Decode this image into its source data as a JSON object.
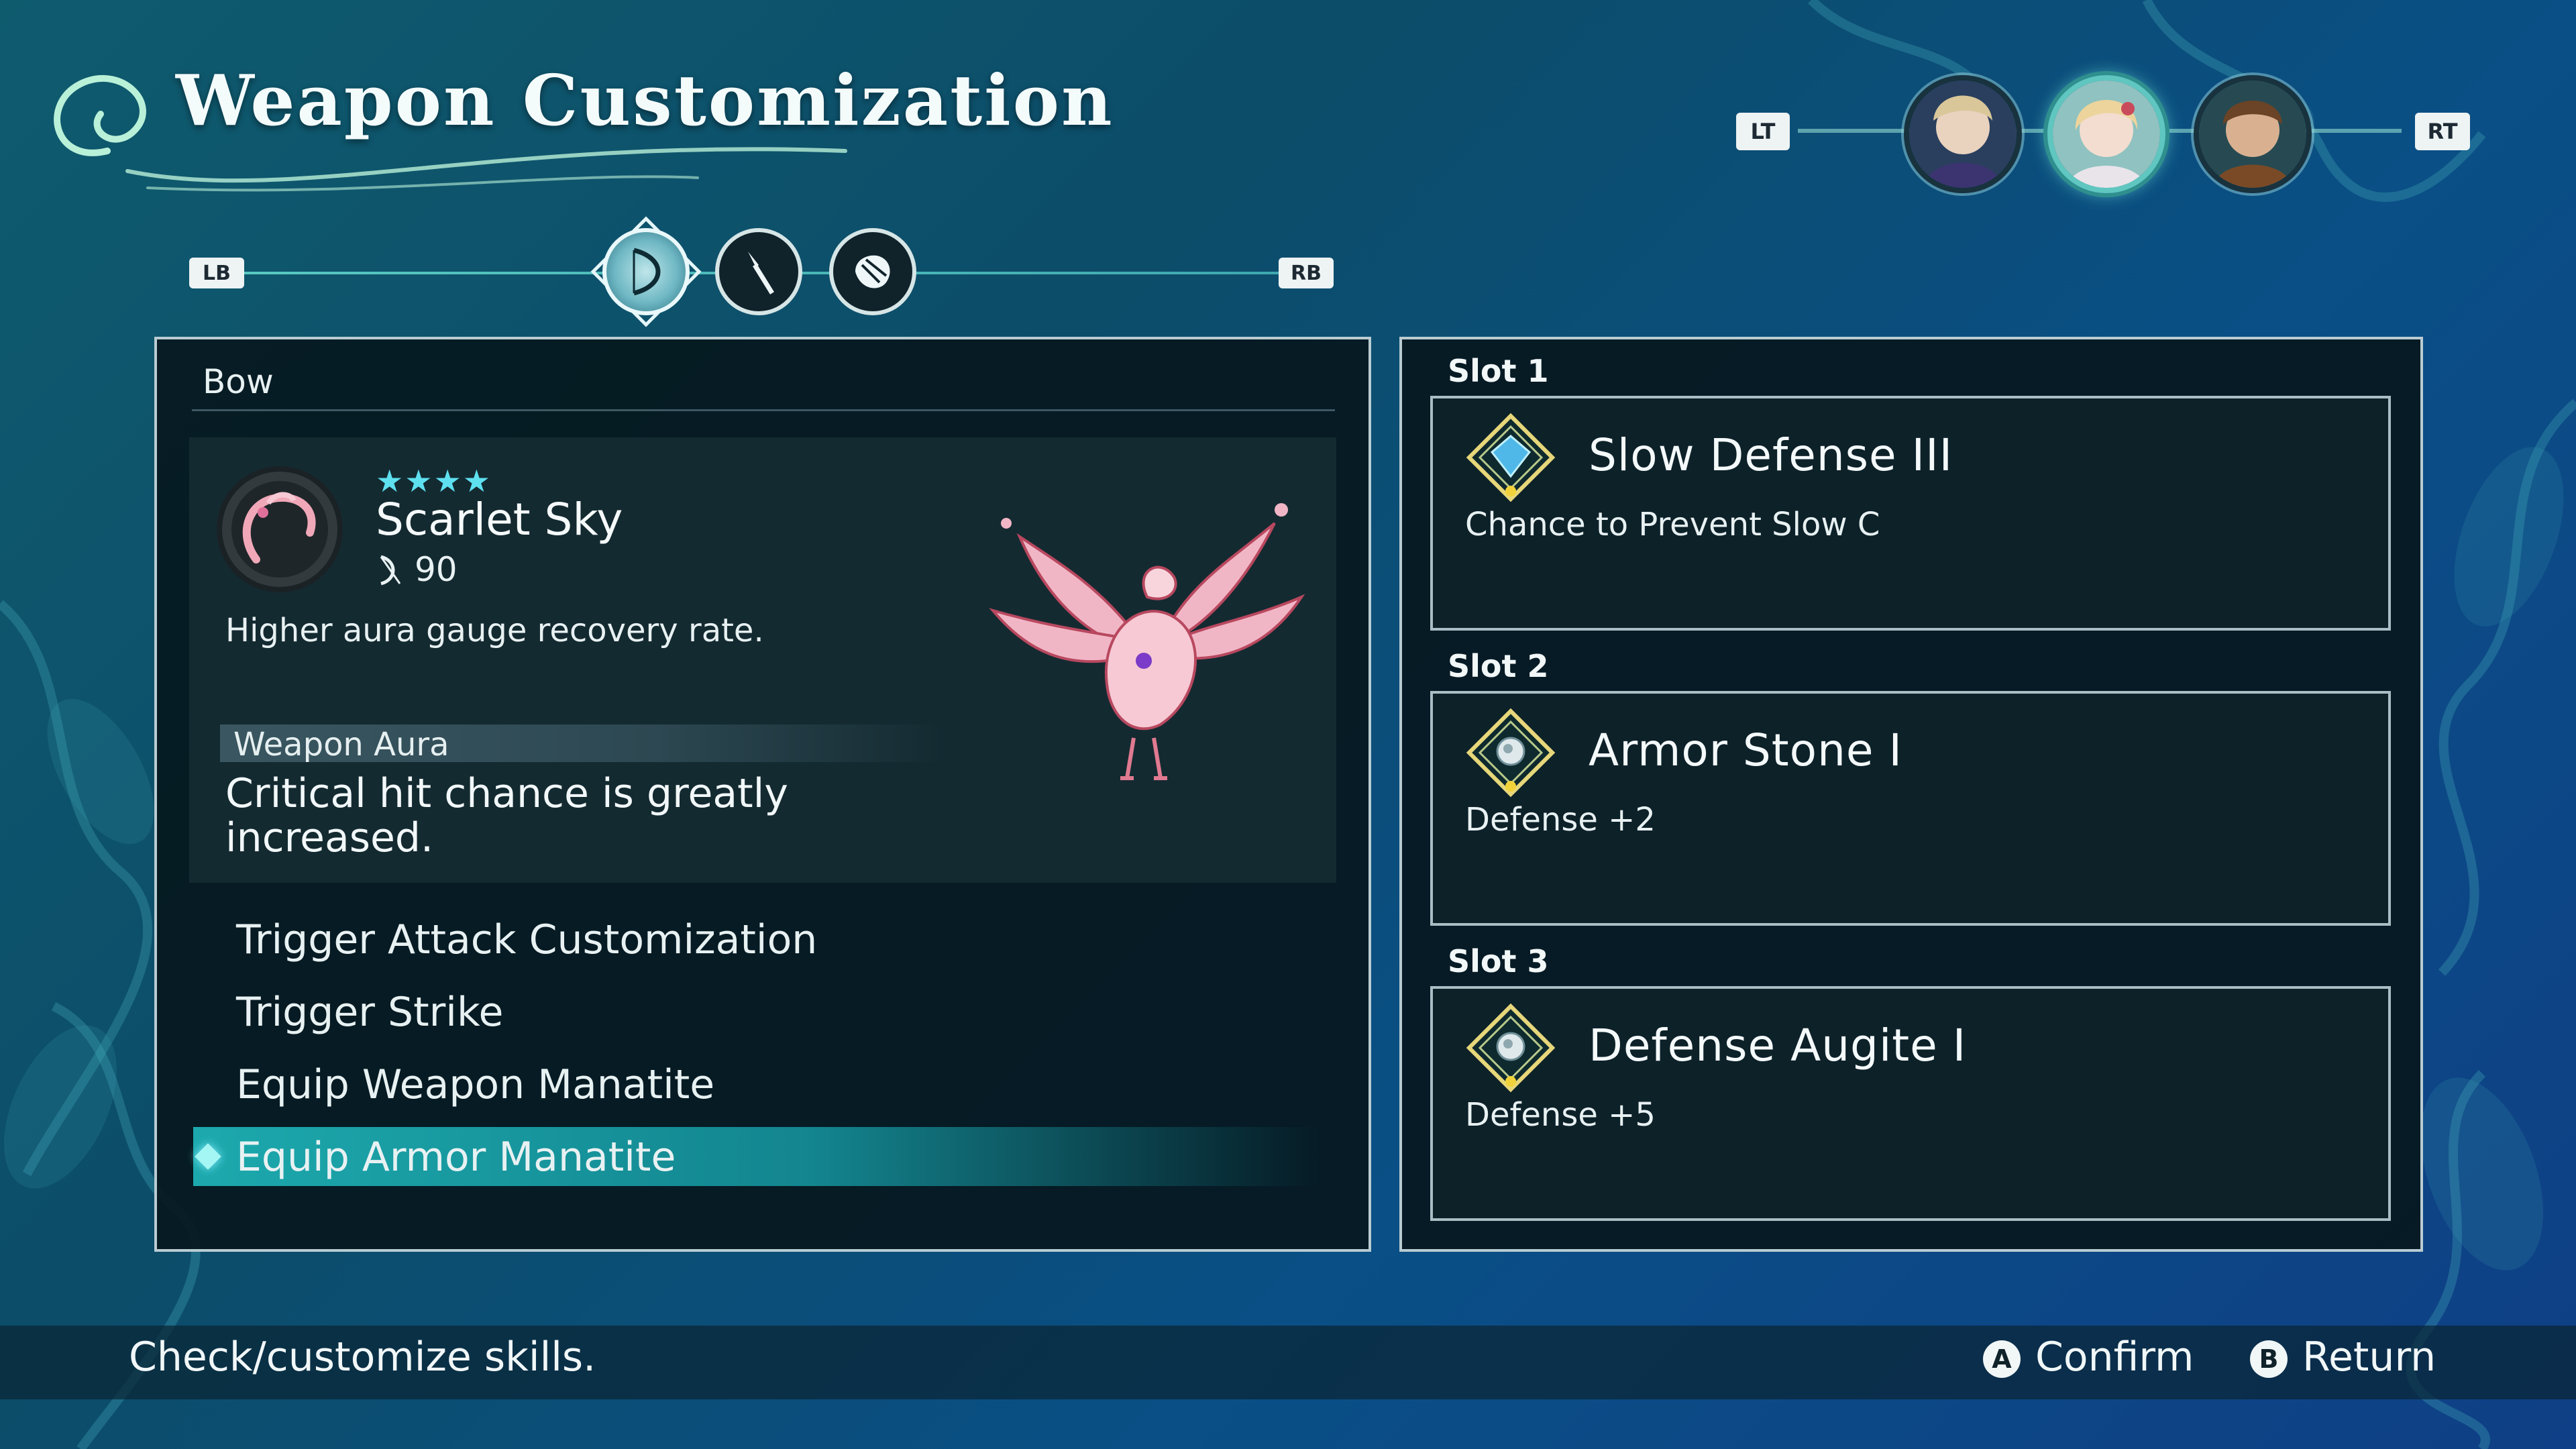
{
  "header": {
    "title": "Weapon Customization",
    "lt_label": "LT",
    "rt_label": "RT",
    "party": [
      {
        "icon": "party-member-1-portrait",
        "selected": false
      },
      {
        "icon": "party-member-2-portrait",
        "selected": true
      },
      {
        "icon": "party-member-3-portrait",
        "selected": false
      }
    ]
  },
  "weapon_tabs": {
    "lb_label": "LB",
    "rb_label": "RB",
    "tabs": [
      {
        "icon": "bow-icon",
        "selected": true
      },
      {
        "icon": "spear-icon",
        "selected": false
      },
      {
        "icon": "armor-icon",
        "selected": false
      }
    ]
  },
  "weapon": {
    "category": "Bow",
    "stars": "★★★★",
    "star_count": 4,
    "name": "Scarlet Sky",
    "power": "90",
    "description": "Higher aura gauge recovery rate.",
    "aura_label": "Weapon Aura",
    "aura_text": "Critical hit chance is greatly increased."
  },
  "menu": {
    "items": [
      {
        "label": "Trigger Attack Customization",
        "selected": false
      },
      {
        "label": "Trigger Strike",
        "selected": false
      },
      {
        "label": "Equip Weapon Manatite",
        "selected": false
      },
      {
        "label": "Equip Armor Manatite",
        "selected": true
      }
    ]
  },
  "slots": [
    {
      "label": "Slot 1",
      "name": "Slow Defense III",
      "desc": "Chance to Prevent Slow C",
      "gem": "blue-manatite-gem-icon"
    },
    {
      "label": "Slot 2",
      "name": "Armor Stone I",
      "desc": "Defense +2",
      "gem": "manatite-gem-icon"
    },
    {
      "label": "Slot 3",
      "name": "Defense Augite I",
      "desc": "Defense +5",
      "gem": "manatite-gem-icon"
    }
  ],
  "footer": {
    "help_text": "Check/customize skills.",
    "a_button": "A",
    "confirm_label": "Confirm",
    "b_button": "B",
    "return_label": "Return"
  },
  "colors": {
    "accent": "#1ca9ad",
    "star": "#5ee0f0",
    "panel": "#06181e",
    "background": "#0c4d6a"
  }
}
